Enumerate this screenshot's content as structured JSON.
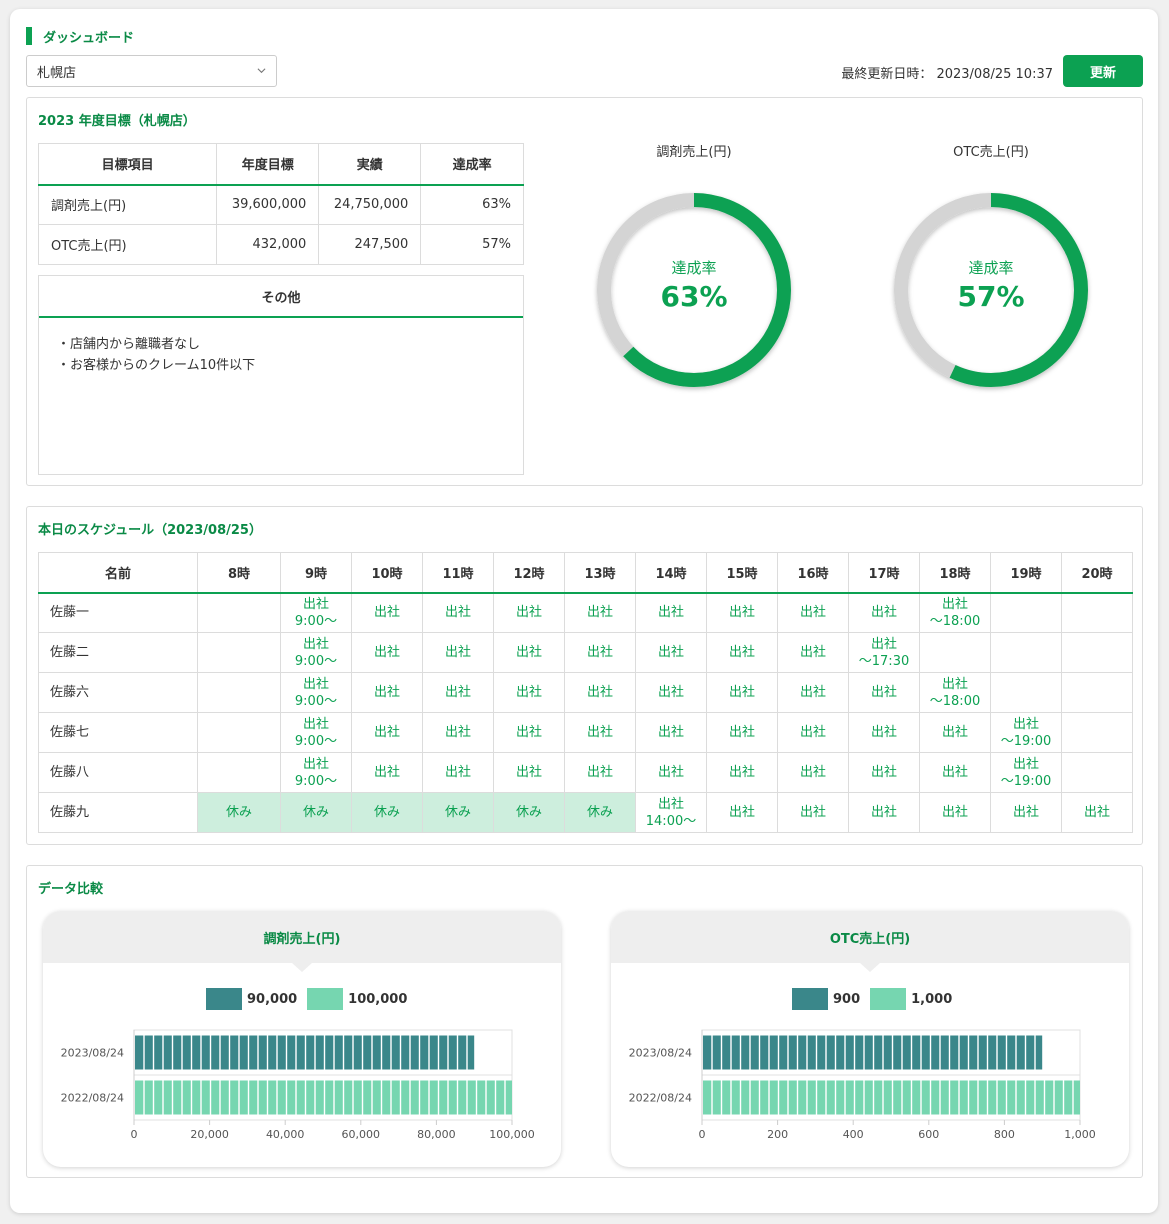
{
  "header": {
    "title": "ダッシュボード",
    "store_select": "札幌店",
    "updated_label": "最終更新日時：",
    "updated_value": "2023/08/25 10:37",
    "refresh_label": "更新"
  },
  "goals": {
    "title": "2023 年度目標（札幌店）",
    "columns": [
      "目標項目",
      "年度目標",
      "実績",
      "達成率"
    ],
    "rows": [
      [
        "調剤売上(円)",
        "39,600,000",
        "24,750,000",
        "63%"
      ],
      [
        "OTC売上(円)",
        "432,000",
        "247,500",
        "57%"
      ]
    ],
    "other_title": "その他",
    "other_items": [
      "・店舗内から離職者なし",
      "・お客様からのクレーム10件以下"
    ]
  },
  "donuts": [
    {
      "label": "調剤売上(円)",
      "center_label": "達成率",
      "value_text": "63%",
      "value": 0.63
    },
    {
      "label": "OTC売上(円)",
      "center_label": "達成率",
      "value_text": "57%",
      "value": 0.57
    }
  ],
  "schedule": {
    "title": "本日のスケジュール（2023/08/25）",
    "columns": [
      "名前",
      "8時",
      "9時",
      "10時",
      "11時",
      "12時",
      "13時",
      "14時",
      "15時",
      "16時",
      "17時",
      "18時",
      "19時",
      "20時"
    ],
    "rows": [
      {
        "name": "佐藤一",
        "cells": [
          "",
          "出社\n9:00〜",
          "出社",
          "出社",
          "出社",
          "出社",
          "出社",
          "出社",
          "出社",
          "出社",
          "出社\n〜18:00",
          "",
          ""
        ]
      },
      {
        "name": "佐藤二",
        "cells": [
          "",
          "出社\n9:00〜",
          "出社",
          "出社",
          "出社",
          "出社",
          "出社",
          "出社",
          "出社",
          "出社\n〜17:30",
          "",
          "",
          ""
        ]
      },
      {
        "name": "佐藤六",
        "cells": [
          "",
          "出社\n9:00〜",
          "出社",
          "出社",
          "出社",
          "出社",
          "出社",
          "出社",
          "出社",
          "出社",
          "出社\n〜18:00",
          "",
          ""
        ]
      },
      {
        "name": "佐藤七",
        "cells": [
          "",
          "出社\n9:00〜",
          "出社",
          "出社",
          "出社",
          "出社",
          "出社",
          "出社",
          "出社",
          "出社",
          "出社",
          "出社\n〜19:00",
          ""
        ]
      },
      {
        "name": "佐藤八",
        "cells": [
          "",
          "出社\n9:00〜",
          "出社",
          "出社",
          "出社",
          "出社",
          "出社",
          "出社",
          "出社",
          "出社",
          "出社",
          "出社\n〜19:00",
          ""
        ]
      },
      {
        "name": "佐藤九",
        "cells": [
          "休み",
          "休み",
          "休み",
          "休み",
          "休み",
          "休み",
          "出社\n14:00〜",
          "出社",
          "出社",
          "出社",
          "出社",
          "出社",
          "出社"
        ]
      }
    ]
  },
  "comparison": {
    "title": "データ比較"
  },
  "chart_data": [
    {
      "type": "bar",
      "orientation": "horizontal",
      "title": "調剤売上(円)",
      "categories": [
        "2023/08/24",
        "2022/08/24"
      ],
      "values": [
        90000,
        100000
      ],
      "legend": [
        "90,000",
        "100,000"
      ],
      "colors": [
        "#3a878a",
        "#76d6b0"
      ],
      "xlim": [
        0,
        100000
      ],
      "xticks": [
        "0",
        "20,000",
        "40,000",
        "60,000",
        "80,000",
        "100,000"
      ],
      "grid": true
    },
    {
      "type": "bar",
      "orientation": "horizontal",
      "title": "OTC売上(円)",
      "categories": [
        "2023/08/24",
        "2022/08/24"
      ],
      "values": [
        900,
        1000
      ],
      "legend": [
        "900",
        "1,000"
      ],
      "colors": [
        "#3a878a",
        "#76d6b0"
      ],
      "xlim": [
        0,
        1000
      ],
      "xticks": [
        "0",
        "200",
        "400",
        "600",
        "800",
        "1,000"
      ],
      "grid": true
    }
  ]
}
